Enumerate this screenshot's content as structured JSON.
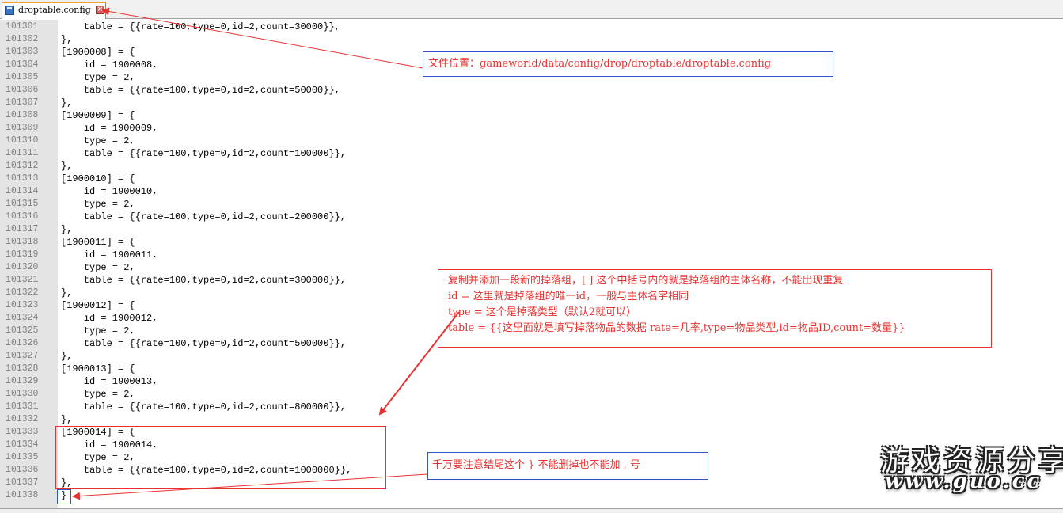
{
  "tab": {
    "title": "droptable.config",
    "save_icon": "save-icon",
    "close_icon": "close-icon"
  },
  "editor": {
    "lines": [
      {
        "no": "101301",
        "text": "    table = {{rate=100,type=0,id=2,count=30000}},"
      },
      {
        "no": "101302",
        "text": "},"
      },
      {
        "no": "101303",
        "text": "[1900008] = {"
      },
      {
        "no": "101304",
        "text": "    id = 1900008,"
      },
      {
        "no": "101305",
        "text": "    type = 2,"
      },
      {
        "no": "101306",
        "text": "    table = {{rate=100,type=0,id=2,count=50000}},"
      },
      {
        "no": "101307",
        "text": "},"
      },
      {
        "no": "101308",
        "text": "[1900009] = {"
      },
      {
        "no": "101309",
        "text": "    id = 1900009,"
      },
      {
        "no": "101310",
        "text": "    type = 2,"
      },
      {
        "no": "101311",
        "text": "    table = {{rate=100,type=0,id=2,count=100000}},"
      },
      {
        "no": "101312",
        "text": "},"
      },
      {
        "no": "101313",
        "text": "[1900010] = {"
      },
      {
        "no": "101314",
        "text": "    id = 1900010,"
      },
      {
        "no": "101315",
        "text": "    type = 2,"
      },
      {
        "no": "101316",
        "text": "    table = {{rate=100,type=0,id=2,count=200000}},"
      },
      {
        "no": "101317",
        "text": "},"
      },
      {
        "no": "101318",
        "text": "[1900011] = {"
      },
      {
        "no": "101319",
        "text": "    id = 1900011,"
      },
      {
        "no": "101320",
        "text": "    type = 2,"
      },
      {
        "no": "101321",
        "text": "    table = {{rate=100,type=0,id=2,count=300000}},"
      },
      {
        "no": "101322",
        "text": "},"
      },
      {
        "no": "101323",
        "text": "[1900012] = {"
      },
      {
        "no": "101324",
        "text": "    id = 1900012,"
      },
      {
        "no": "101325",
        "text": "    type = 2,"
      },
      {
        "no": "101326",
        "text": "    table = {{rate=100,type=0,id=2,count=500000}},"
      },
      {
        "no": "101327",
        "text": "},"
      },
      {
        "no": "101328",
        "text": "[1900013] = {"
      },
      {
        "no": "101329",
        "text": "    id = 1900013,"
      },
      {
        "no": "101330",
        "text": "    type = 2,"
      },
      {
        "no": "101331",
        "text": "    table = {{rate=100,type=0,id=2,count=800000}},"
      },
      {
        "no": "101332",
        "text": "},"
      },
      {
        "no": "101333",
        "text": "[1900014] = {"
      },
      {
        "no": "101334",
        "text": "    id = 1900014,"
      },
      {
        "no": "101335",
        "text": "    type = 2,"
      },
      {
        "no": "101336",
        "text": "    table = {{rate=100,type=0,id=2,count=1000000}},"
      },
      {
        "no": "101337",
        "text": "},"
      },
      {
        "no": "101338",
        "text": "}"
      }
    ]
  },
  "annotations": {
    "file_location": "文件位置：gameworld/data/config/drop/droptable/droptable.config",
    "explain": [
      "复制并添加一段新的掉落组，[ ] 这个中括号内的就是掉落组的主体名称，不能出现重复",
      "id = 这里就是掉落组的唯一id，一般与主体名字相同",
      "type = 这个是掉落类型（默认2就可以）",
      "table = {{这里面就是填写掉落物品的数据 rate=几率,type=物品类型,id=物品ID,count=数量}}"
    ],
    "warning": "千万要注意结尾这个 } 不能删掉也不能加 , 号",
    "arrow_color": "#e8322f",
    "box_blue": "#3355cc"
  },
  "watermark": {
    "title": "游戏资源分享",
    "url": "www.guo.cc"
  }
}
